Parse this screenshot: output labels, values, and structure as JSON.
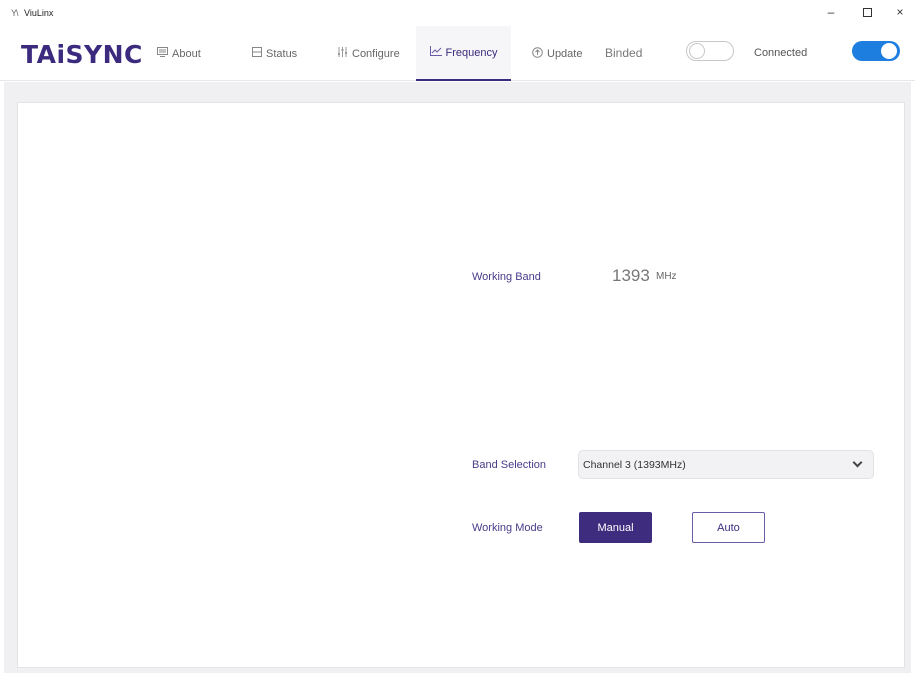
{
  "window": {
    "title": "ViuLinx",
    "app_icon": "Y\\",
    "minimize_glyph": "–",
    "close_glyph": "×"
  },
  "brand": {
    "logo": "TAiSYNC",
    "color": "#3b2a7d"
  },
  "nav": {
    "items": [
      {
        "label": "About",
        "icon": "monitor-icon"
      },
      {
        "label": "Status",
        "icon": "status-icon"
      },
      {
        "label": "Configure",
        "icon": "sliders-icon"
      },
      {
        "label": "Frequency",
        "icon": "chart-line-icon",
        "active": true
      },
      {
        "label": "Update",
        "icon": "upload-circle-icon"
      }
    ]
  },
  "status": {
    "binded_label": "Binded",
    "binded_on": false,
    "connected_label": "Connected",
    "connected_on": true,
    "toggle_on_color": "#1e7ee0"
  },
  "frequency": {
    "working_band_label": "Working Band",
    "working_band_value": "1393",
    "working_band_unit": "MHz",
    "band_selection_label": "Band Selection",
    "band_selection_value": "Channel 3 (1393MHz)",
    "working_mode_label": "Working Mode",
    "modes": [
      {
        "label": "Manual",
        "selected": true
      },
      {
        "label": "Auto",
        "selected": false
      }
    ]
  }
}
